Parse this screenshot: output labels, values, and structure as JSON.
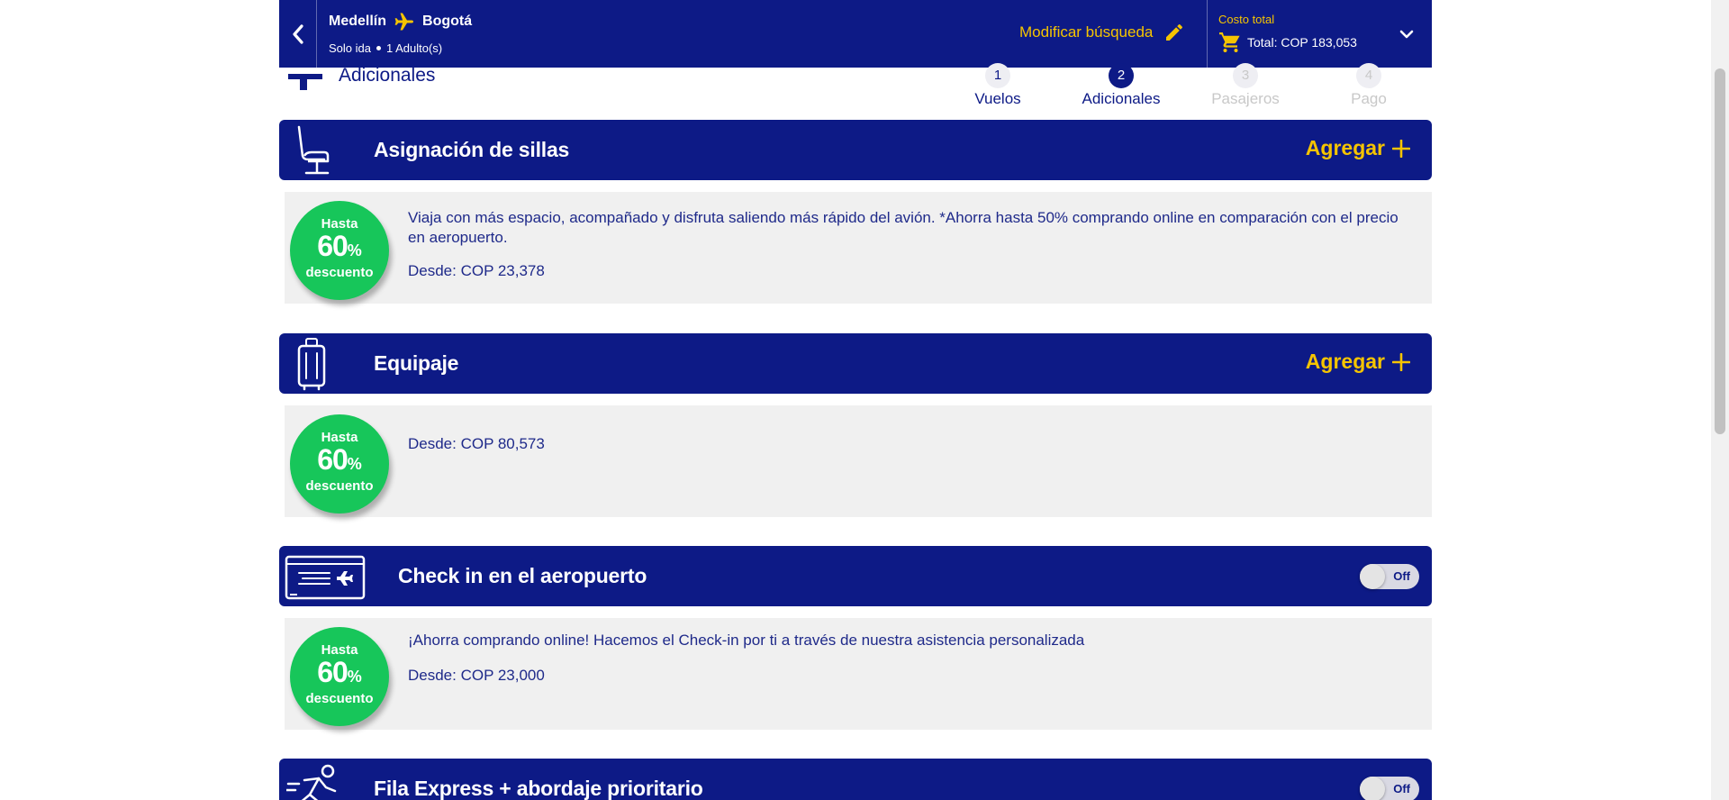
{
  "header": {
    "origin": "Medellín",
    "destination": "Bogotá",
    "trip_type": "Solo ida",
    "passengers": "1 Adulto(s)",
    "modify_label": "Modificar búsqueda",
    "cost_label": "Costo total",
    "total": "Total: COP 183,053"
  },
  "section": {
    "title": "Adicionales"
  },
  "steps": [
    {
      "num": "1",
      "label": "Vuelos",
      "state": "done"
    },
    {
      "num": "2",
      "label": "Adicionales",
      "state": "active"
    },
    {
      "num": "3",
      "label": "Pasajeros",
      "state": "pending"
    },
    {
      "num": "4",
      "label": "Pago",
      "state": "pending"
    }
  ],
  "badge": {
    "top": "Hasta",
    "value": "60",
    "unit": "%",
    "bottom": "descuento"
  },
  "services": [
    {
      "title": "Asignación de sillas",
      "icon": "seat-icon",
      "action": "Agregar",
      "description": "Viaja con más espacio, acompañado y disfruta saliendo más rápido del avión. *Ahorra hasta 50% comprando online en comparación con el precio en aeropuerto.",
      "price": "Desde: COP 23,378"
    },
    {
      "title": "Equipaje",
      "icon": "suitcase-icon",
      "action": "Agregar",
      "description": "",
      "price": "Desde: COP 80,573"
    },
    {
      "title": "Check in en el aeropuerto",
      "icon": "boarding-pass-icon",
      "toggle": "Off",
      "description": "¡Ahorra comprando online! Hacemos el Check-in por ti a través de nuestra asistencia personalizada",
      "price": "Desde: COP 23,000"
    },
    {
      "title": "Fila Express + abordaje prioritario",
      "icon": "running-person-icon",
      "toggle": "Off"
    }
  ],
  "colors": {
    "brand": "#0d1a86",
    "accent": "#f5c400",
    "badge": "#17c65a"
  }
}
